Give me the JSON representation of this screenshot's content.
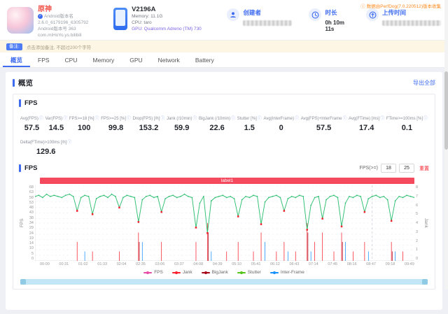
{
  "header": {
    "app": {
      "name": "原神",
      "lines": [
        "Android版本名",
        "2.6.0_6179196_6305792",
        "Android版本号  363",
        "com.miHoYo.ys.bilibili"
      ]
    },
    "device": {
      "model": "V2196A",
      "memory": "Memory: 11.1G",
      "cpu": "CPU: taro",
      "gpu": "GPU: Qualcomm Adreno (TM) 730"
    },
    "creator_label": "创建者",
    "duration_label": "时长",
    "duration_value": "0h 10m 11s",
    "upload_label": "上传时间",
    "perfdog_note": "数据由PerfDog(7.0.220512)版本收集"
  },
  "notice": {
    "badge": "备注:",
    "text": "点击添加备注, 不超过200个字符"
  },
  "tabs": [
    {
      "label": "概览",
      "active": true
    },
    {
      "label": "FPS",
      "active": false
    },
    {
      "label": "CPU",
      "active": false
    },
    {
      "label": "Memory",
      "active": false
    },
    {
      "label": "GPU",
      "active": false
    },
    {
      "label": "Network",
      "active": false
    },
    {
      "label": "Battery",
      "active": false
    }
  ],
  "overview": {
    "title": "概览",
    "export_label": "导出全部"
  },
  "fps_panel": {
    "title": "FPS",
    "chart_title": "FPS",
    "metrics": [
      {
        "label": "Avg(FPS)",
        "value": "57.5"
      },
      {
        "label": "Var(FPS)",
        "value": "14.5"
      },
      {
        "label": "FPS>=18 [%]",
        "value": "100"
      },
      {
        "label": "FPS>=25 [%]",
        "value": "99.8"
      },
      {
        "label": "Drop(FPS) [/h]",
        "value": "153.2"
      },
      {
        "label": "Jank (/10min)",
        "value": "59.9"
      },
      {
        "label": "BigJank (/10min)",
        "value": "22.6"
      },
      {
        "label": "Stutter [%]",
        "value": "1.5"
      },
      {
        "label": "Avg(InterFrame)",
        "value": "0"
      },
      {
        "label": "Avg(FPS)+InterFrame",
        "value": "57.5"
      },
      {
        "label": "Avg(FTime) [ms]",
        "value": "17.4"
      },
      {
        "label": "FTime>=100ms [%]",
        "value": "0.1"
      },
      {
        "label": "Delta(FTime)>100ms [/h]",
        "value": "129.6"
      }
    ],
    "filter": {
      "label": "FPS(>=)",
      "low": "18",
      "high": "25",
      "action": "重置"
    }
  },
  "chart_data": {
    "type": "line",
    "title": "FPS",
    "banner_label": "label1",
    "ylabel_left": "FPS",
    "ylabel_right": "Jank",
    "ylim_left": [
      0,
      68
    ],
    "ylim_right": [
      0,
      8
    ],
    "yticks_left": [
      0,
      5,
      10,
      14,
      19,
      24,
      29,
      34,
      38,
      43,
      48,
      53,
      58,
      63,
      68
    ],
    "yticks_right": [
      0,
      1,
      2,
      3,
      4,
      5,
      6,
      7,
      8
    ],
    "x_ticks": [
      "00:00",
      "00:31",
      "01:02",
      "01:33",
      "02:04",
      "02:35",
      "03:06",
      "03:37",
      "04:08",
      "04:39",
      "05:10",
      "05:41",
      "06:12",
      "06:43",
      "07:14",
      "07:45",
      "08:16",
      "08:47",
      "09:18",
      "09:49"
    ],
    "grid": true,
    "cursor_index": 88,
    "series": [
      {
        "name": "FPS",
        "values": [
          58,
          59,
          57,
          60,
          58,
          59,
          58,
          57,
          59,
          60,
          58,
          45,
          57,
          59,
          58,
          42,
          56,
          58,
          59,
          57,
          60,
          58,
          48,
          57,
          59,
          58,
          57,
          35,
          55,
          58,
          59,
          57,
          58,
          44,
          56,
          58,
          59,
          57,
          58,
          60,
          58,
          57,
          30,
          52,
          58,
          25,
          54,
          57,
          58,
          59,
          57,
          58,
          56,
          40,
          55,
          58,
          57,
          59,
          58,
          33,
          53,
          57,
          58,
          59,
          57,
          45,
          56,
          58,
          57,
          59,
          58,
          28,
          50,
          57,
          58,
          38,
          55,
          58,
          59,
          57,
          31,
          52,
          58,
          57,
          59,
          58,
          44,
          56,
          58,
          59,
          57,
          58,
          55,
          36,
          54,
          58,
          57,
          59,
          58,
          57
        ]
      }
    ],
    "jank_spikes": [
      [
        11,
        2
      ],
      [
        15,
        1
      ],
      [
        22,
        1
      ],
      [
        27,
        3
      ],
      [
        33,
        2
      ],
      [
        42,
        2
      ],
      [
        45,
        4
      ],
      [
        50,
        1
      ],
      [
        53,
        2
      ],
      [
        57,
        1
      ],
      [
        59,
        3
      ],
      [
        63,
        1
      ],
      [
        65,
        2
      ],
      [
        68,
        1
      ],
      [
        71,
        4
      ],
      [
        73,
        2
      ],
      [
        75,
        3
      ],
      [
        78,
        1
      ],
      [
        80,
        3
      ],
      [
        83,
        1
      ],
      [
        86,
        2
      ],
      [
        93,
        2
      ],
      [
        96,
        1
      ]
    ],
    "bigjank_spikes": [
      [
        27,
        2
      ],
      [
        45,
        3
      ],
      [
        71,
        3
      ],
      [
        80,
        2
      ],
      [
        93,
        1
      ]
    ],
    "interframe_spikes": [
      [
        13,
        1
      ],
      [
        28,
        2
      ],
      [
        46,
        1
      ],
      [
        60,
        2
      ],
      [
        66,
        1
      ],
      [
        72,
        1
      ],
      [
        81,
        2
      ],
      [
        87,
        1
      ],
      [
        94,
        1
      ]
    ],
    "colors": {
      "fps_line": "#2fbf71",
      "jank": "#f5222d",
      "bigjank": "#a8071a",
      "interframe": "#1890ff",
      "grid": "#eceef3",
      "banner": "#f5495e"
    },
    "legend": [
      {
        "label": "FPS",
        "color": "#e64ca6"
      },
      {
        "label": "Jank",
        "color": "#f5222d"
      },
      {
        "label": "BigJank",
        "color": "#a8071a"
      },
      {
        "label": "Stutter",
        "color": "#52c41a"
      },
      {
        "label": "Inter-Frame",
        "color": "#1890ff"
      }
    ],
    "legend_position": "bottom"
  }
}
